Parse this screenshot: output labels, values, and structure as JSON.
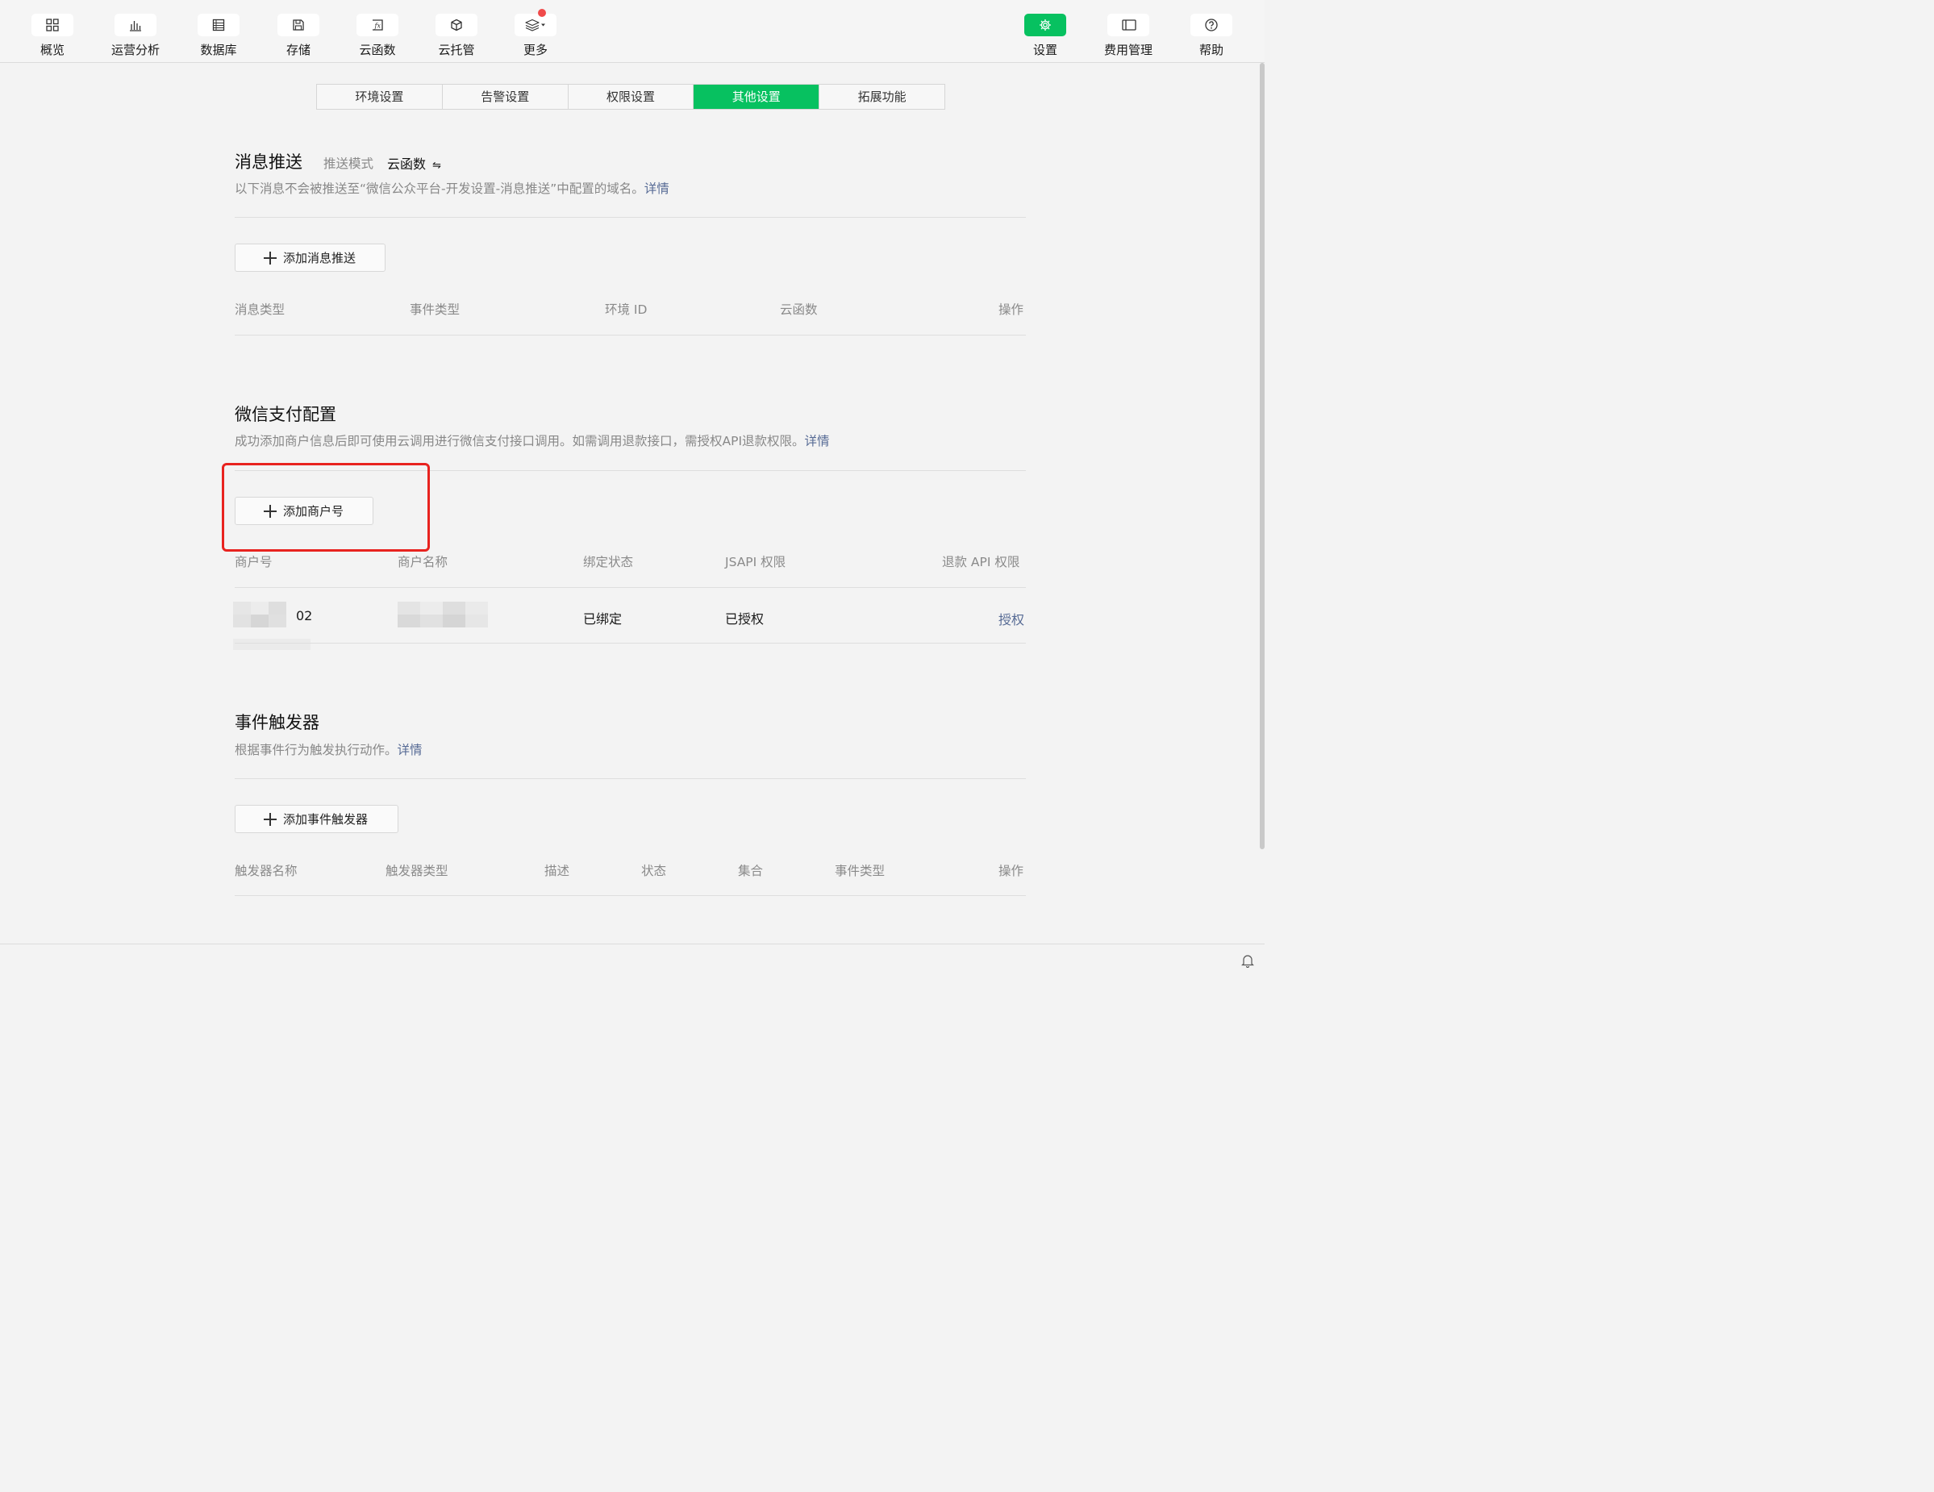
{
  "toolbar": {
    "left_items": [
      {
        "label": "概览",
        "icon": "overview-grid-icon"
      },
      {
        "label": "运营分析",
        "icon": "bar-chart-icon"
      },
      {
        "label": "数据库",
        "icon": "database-icon"
      },
      {
        "label": "存储",
        "icon": "storage-icon"
      },
      {
        "label": "云函数",
        "icon": "function-icon"
      },
      {
        "label": "云托管",
        "icon": "cube-icon"
      },
      {
        "label": "更多",
        "icon": "layers-dropdown-icon"
      }
    ],
    "right_items": [
      {
        "label": "设置",
        "icon": "gear-icon"
      },
      {
        "label": "费用管理",
        "icon": "billing-icon"
      },
      {
        "label": "帮助",
        "icon": "help-icon"
      }
    ],
    "accent_color": "#07c160"
  },
  "tabs": [
    "环境设置",
    "告警设置",
    "权限设置",
    "其他设置",
    "拓展功能"
  ],
  "active_tab": "其他设置",
  "message_push": {
    "title": "消息推送",
    "mode_label": "推送模式",
    "mode_value": "云函数",
    "description": "以下消息不会被推送至“微信公众平台-开发设置-消息推送”中配置的域名。",
    "detail_link": "详情",
    "add_button": "添加消息推送",
    "columns": [
      "消息类型",
      "事件类型",
      "环境 ID",
      "云函数",
      "操作"
    ]
  },
  "wechat_pay": {
    "title": "微信支付配置",
    "description": "成功添加商户信息后即可使用云调用进行微信支付接口调用。如需调用退款接口，需授权API退款权限。",
    "detail_link": "详情",
    "add_button": "添加商户号",
    "columns": [
      "商户号",
      "商户名称",
      "绑定状态",
      "JSAPI 权限",
      "退款 API 权限"
    ],
    "rows": [
      {
        "merchant_id_visible_suffix": "02",
        "bind_status": "已绑定",
        "jsapi": "已授权",
        "refund_action": "授权"
      }
    ]
  },
  "event_trigger": {
    "title": "事件触发器",
    "description": "根据事件行为触发执行动作。",
    "detail_link": "详情",
    "add_button": "添加事件触发器",
    "columns": [
      "触发器名称",
      "触发器类型",
      "描述",
      "状态",
      "集合",
      "事件类型",
      "操作"
    ]
  }
}
